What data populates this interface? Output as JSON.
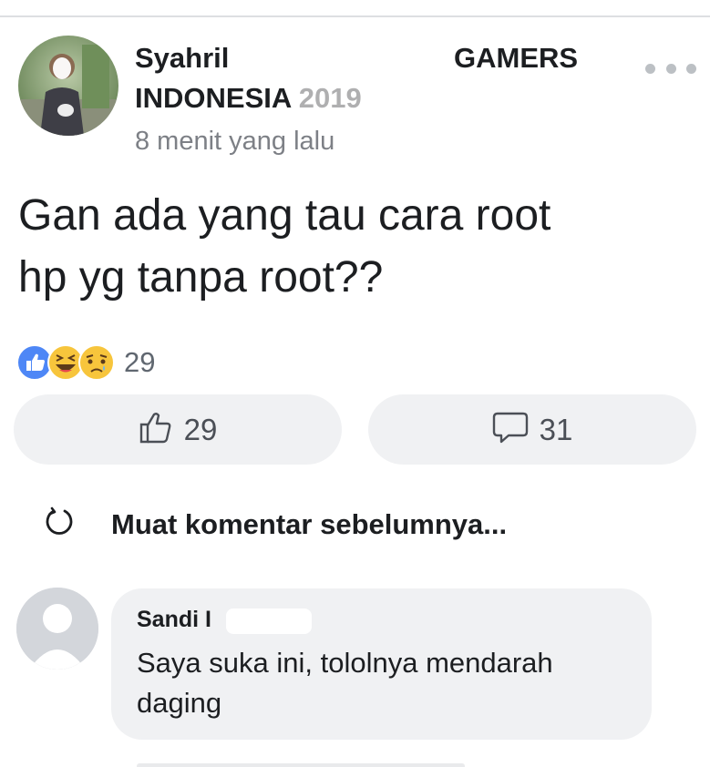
{
  "post": {
    "author_name": "Syahril",
    "group_name_line1": "GAMERS",
    "group_name_line2": "INDONESIA",
    "group_year_faded": "2019",
    "timestamp": "8 menit yang lalu",
    "body": "Gan ada yang tau cara root\nhp yg tanpa root??",
    "reactions": {
      "icons": [
        "like-reaction-icon",
        "haha-reaction-icon",
        "sad-reaction-icon"
      ],
      "count": "29"
    },
    "actions": {
      "like_count": "29",
      "comment_count": "31"
    }
  },
  "comments_section": {
    "load_more_label": "Muat komentar sebelumnya..."
  },
  "comment": {
    "author_name": "Sandi I",
    "text": "Saya suka ini, tololnya mendarah daging"
  },
  "colors": {
    "like_blue": "#4e87f6",
    "reaction_yellow": "#f7c53c",
    "pill_bg": "#f0f1f3",
    "muted_text": "#7d8086"
  }
}
